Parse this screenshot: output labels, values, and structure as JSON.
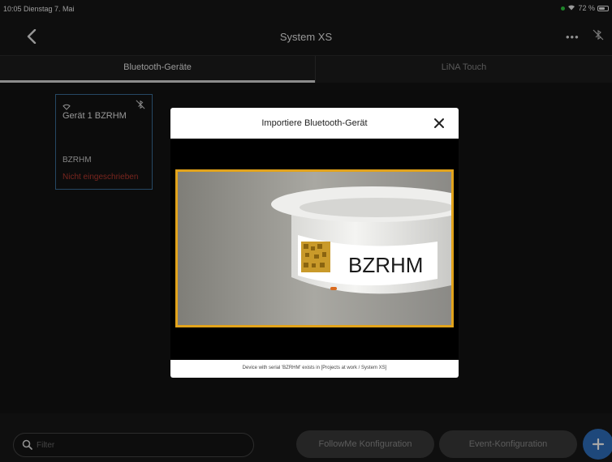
{
  "status_bar": {
    "time_date": "10:05  Dienstag 7. Mai",
    "battery": "72 %",
    "battery_level": 0.72,
    "colors": {
      "recording_dot": "#2ecc40"
    }
  },
  "nav": {
    "title": "System XS",
    "back_icon": "chevron-left-icon",
    "more_label": "•••",
    "bluetooth_icon": "bluetooth-disabled-icon"
  },
  "tabs": [
    {
      "label": "Bluetooth-Geräte",
      "active": true
    },
    {
      "label": "LiNA Touch",
      "active": false
    }
  ],
  "devices": [
    {
      "name": "Gerät 1 BZRHM",
      "serial": "BZRHM",
      "status": "Nicht eingeschrieben",
      "icons": [
        "wifi-icon",
        "bluetooth-disabled-icon"
      ]
    }
  ],
  "modal": {
    "title": "Importiere Bluetooth-Gerät",
    "close_icon": "close-icon",
    "scanned_label": "BZRHM",
    "footer": "Device with serial 'BZRHM' exists in [Projects at work / System XS]",
    "colors": {
      "scan_frame": "#e2a31b"
    }
  },
  "bottom": {
    "filter_placeholder": "Filter",
    "followme_label": "FollowMe Konfiguration",
    "event_label": "Event-Konfiguration",
    "add_icon": "plus-icon",
    "colors": {
      "accent": "#2f6fbd",
      "error": "#b93a2e"
    }
  }
}
